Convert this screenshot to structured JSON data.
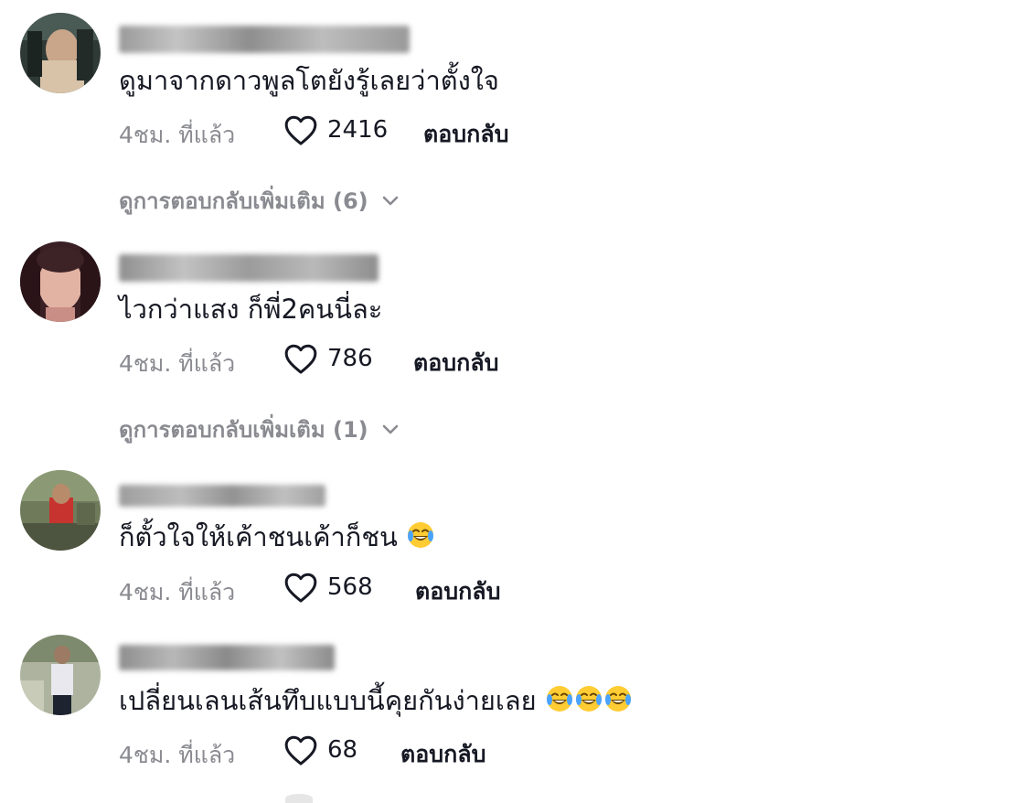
{
  "comments": [
    {
      "text": "ดูมาจากดาวพูลโตยังรู้เลยว่าตั้งใจ",
      "time": "4ชม. ที่แล้ว",
      "likes": "2416",
      "reply_label": "ตอบกลับ",
      "more_replies": "ดูการตอบกลับเพิ่มเติม (6)"
    },
    {
      "text": "ไวกว่าแสง ก็พี่2คนนี่ละ",
      "time": "4ชม. ที่แล้ว",
      "likes": "786",
      "reply_label": "ตอบกลับ",
      "more_replies": "ดูการตอบกลับเพิ่มเติม (1)"
    },
    {
      "text": "ก็ตั้วใจให้เค้าชนเค้าก็ชน",
      "time": "4ชม. ที่แล้ว",
      "likes": "568",
      "reply_label": "ตอบกลับ"
    },
    {
      "text": "เปลี่ยนเลนเส้นทึบแบบนี้คุยกันง่ายเลย",
      "time": "4ชม. ที่แล้ว",
      "likes": "68",
      "reply_label": "ตอบกลับ"
    }
  ],
  "icons": {
    "like": "heart-outline-icon",
    "expand": "chevron-down-icon",
    "emoji": "face-with-tears-of-joy-emoji"
  },
  "colors": {
    "primary_text": "#161823",
    "secondary_text": "#8a8b91"
  }
}
